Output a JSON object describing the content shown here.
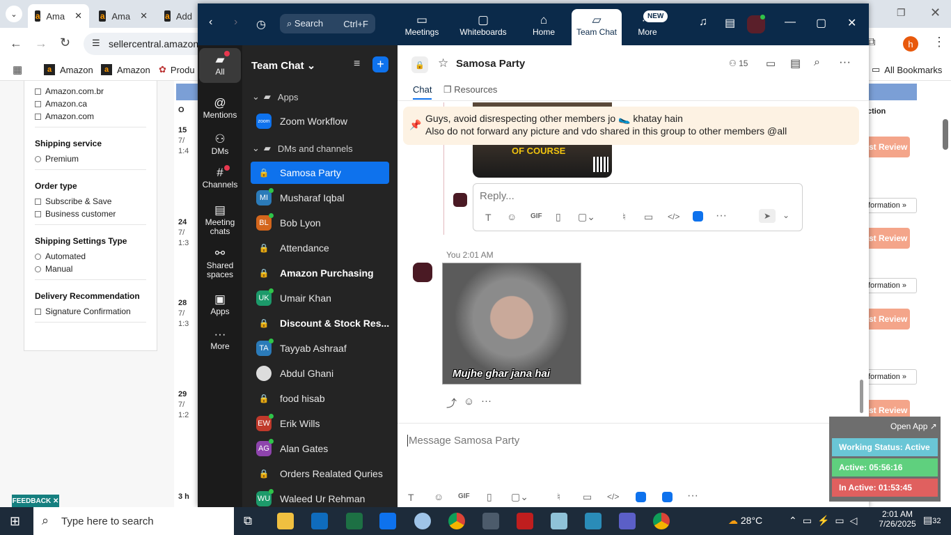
{
  "browser": {
    "tabs": [
      {
        "label": "Ama"
      },
      {
        "label": "Ama"
      },
      {
        "label": "Add"
      }
    ],
    "url": "sellercentral.amazon",
    "bookmarks": [
      {
        "label": "Amazon"
      },
      {
        "label": "Amazon"
      },
      {
        "label": "Produ"
      }
    ],
    "all_bookmarks": "All Bookmarks",
    "profile": "h"
  },
  "seller": {
    "marketplaces": [
      "Amazon.com.br",
      "Amazon.ca",
      "Amazon.com"
    ],
    "shipping_service_title": "Shipping service",
    "shipping_service_options": [
      "Premium"
    ],
    "order_type_title": "Order type",
    "order_type_options": [
      "Subscribe & Save",
      "Business customer"
    ],
    "shipping_settings_title": "Shipping Settings Type",
    "shipping_settings_options": [
      "Automated",
      "Manual"
    ],
    "delivery_title": "Delivery Recommendation",
    "delivery_options": [
      "Signature Confirmation"
    ],
    "order_col_header": "O",
    "order_rows": [
      {
        "a": "15",
        "b": "7/",
        "c": "1:4"
      },
      {
        "a": "24",
        "b": "7/",
        "c": "1:3"
      },
      {
        "a": "28",
        "b": "7/",
        "c": "1:3"
      },
      {
        "a": "29",
        "b": "7/",
        "c": "1:2"
      },
      {
        "a": "3 h",
        "b": "",
        "c": ""
      }
    ],
    "action_header": "ction",
    "review_label": "st Review",
    "info_label": "formation »",
    "feedback": "FEEDBACK ✕"
  },
  "zoom": {
    "search_label": "Search",
    "search_shortcut": "Ctrl+F",
    "nav": [
      {
        "label": "Meetings"
      },
      {
        "label": "Whiteboards"
      },
      {
        "label": "Home"
      },
      {
        "label": "Team Chat"
      },
      {
        "label": "More"
      }
    ],
    "new_badge": "NEW",
    "rail": [
      {
        "label": "All"
      },
      {
        "label": "Mentions"
      },
      {
        "label": "DMs"
      },
      {
        "label": "Channels"
      },
      {
        "label": "Meeting chats"
      },
      {
        "label": "Shared spaces"
      },
      {
        "label": "Apps"
      },
      {
        "label": "More"
      }
    ],
    "list_title": "Team Chat",
    "apps_section": "Apps",
    "zoom_workflow": "Zoom Workflow",
    "dm_section": "DMs and channels",
    "channels": [
      {
        "name": "Samosa Party",
        "type": "lock",
        "selected": true
      },
      {
        "name": "Musharaf Iqbal",
        "type": "avatar",
        "initials": "MI",
        "color": "#2b7bb9"
      },
      {
        "name": "Bob Lyon",
        "type": "avatar",
        "initials": "BL",
        "color": "#d4661c"
      },
      {
        "name": "Attendance",
        "type": "lock"
      },
      {
        "name": "Amazon Purchasing",
        "type": "lock",
        "bold": true
      },
      {
        "name": "Umair Khan",
        "type": "avatar",
        "initials": "UK",
        "color": "#1c9a6a"
      },
      {
        "name": "Discount & Stock Res...",
        "type": "lock",
        "bold": true
      },
      {
        "name": "Tayyab Ashraaf",
        "type": "avatar",
        "initials": "TA",
        "color": "#2b7bb9"
      },
      {
        "name": "Abdul Ghani",
        "type": "photo"
      },
      {
        "name": "food hisab",
        "type": "lock"
      },
      {
        "name": "Erik Wills",
        "type": "avatar",
        "initials": "EW",
        "color": "#c0392b"
      },
      {
        "name": "Alan Gates",
        "type": "avatar",
        "initials": "AG",
        "color": "#8e44ad"
      },
      {
        "name": "Orders Realated Quries",
        "type": "lock"
      },
      {
        "name": "Waleed Ur Rehman",
        "type": "avatar",
        "initials": "WU",
        "color": "#1c9a6a"
      }
    ],
    "chat": {
      "title": "Samosa Party",
      "members": "15",
      "tabs": [
        {
          "label": "Chat"
        },
        {
          "label": "Resources"
        }
      ],
      "pinned_line1": "Guys, avoid disrespecting other members jo 🥿 khatay hain",
      "pinned_line2": "Also do not forward any picture and vdo shared in this group to other members @all",
      "meme_caption_top": "OF COURSE",
      "reply_placeholder": "Reply...",
      "msg_meta": "You 2:01 AM",
      "meme_caption": "Mujhe ghar jana hai",
      "composer_placeholder": "Message Samosa Party"
    }
  },
  "overlay": {
    "open_app": "Open App ↗",
    "working_status": "Working Status: Active",
    "active": "Active: 05:56:16",
    "inactive": "In Active: 01:53:45"
  },
  "taskbar": {
    "search": "Type here to search",
    "weather": "28°C",
    "time": "2:01 AM",
    "date": "7/26/2025",
    "notifications": "32"
  }
}
